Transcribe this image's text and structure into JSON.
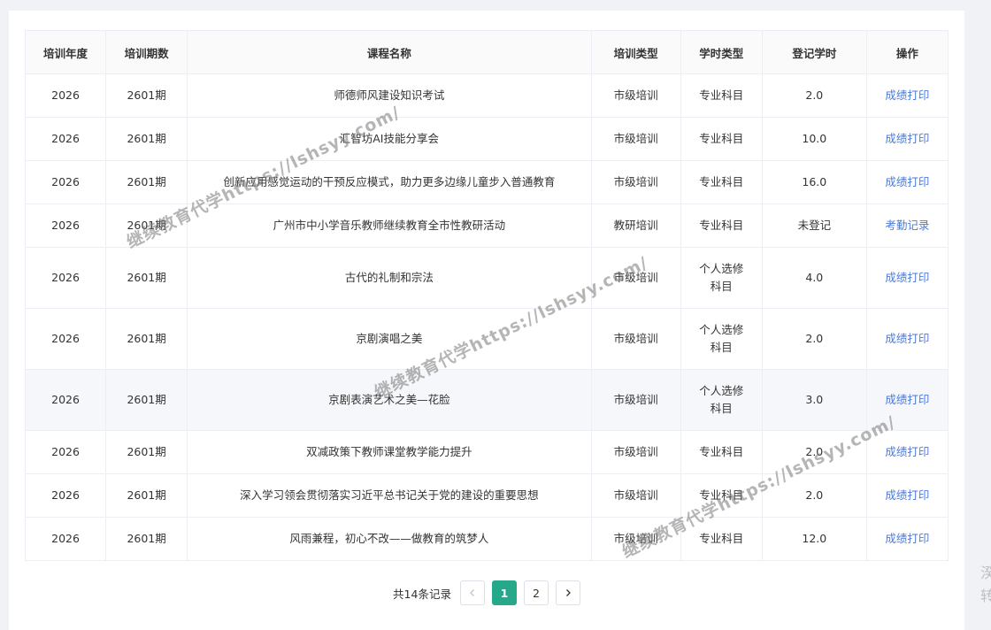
{
  "table": {
    "headers": [
      "培训年度",
      "培训期数",
      "课程名称",
      "培训类型",
      "学时类型",
      "登记学时",
      "操作"
    ],
    "rows": [
      {
        "year": "2026",
        "period": "2601期",
        "course": "师德师风建设知识考试",
        "type": "市级培训",
        "hour_type": "专业科目",
        "hours": "2.0",
        "action": "成绩打印"
      },
      {
        "year": "2026",
        "period": "2601期",
        "course": "汇智坊AI技能分享会",
        "type": "市级培训",
        "hour_type": "专业科目",
        "hours": "10.0",
        "action": "成绩打印"
      },
      {
        "year": "2026",
        "period": "2601期",
        "course": "创新应用感觉运动的干预反应模式，助力更多边缘儿童步入普通教育",
        "type": "市级培训",
        "hour_type": "专业科目",
        "hours": "16.0",
        "action": "成绩打印"
      },
      {
        "year": "2026",
        "period": "2601期",
        "course": "广州市中小学音乐教师继续教育全市性教研活动",
        "type": "教研培训",
        "hour_type": "专业科目",
        "hours": "未登记",
        "action": "考勤记录"
      },
      {
        "year": "2026",
        "period": "2601期",
        "course": "古代的礼制和宗法",
        "type": "市级培训",
        "hour_type_l1": "个人选修",
        "hour_type_l2": "科目",
        "hours": "4.0",
        "action": "成绩打印"
      },
      {
        "year": "2026",
        "period": "2601期",
        "course": "京剧演唱之美",
        "type": "市级培训",
        "hour_type_l1": "个人选修",
        "hour_type_l2": "科目",
        "hours": "2.0",
        "action": "成绩打印"
      },
      {
        "year": "2026",
        "period": "2601期",
        "course": "京剧表演艺术之美—花脸",
        "type": "市级培训",
        "hour_type_l1": "个人选修",
        "hour_type_l2": "科目",
        "hours": "3.0",
        "action": "成绩打印"
      },
      {
        "year": "2026",
        "period": "2601期",
        "course": "双减政策下教师课堂教学能力提升",
        "type": "市级培训",
        "hour_type": "专业科目",
        "hours": "2.0",
        "action": "成绩打印"
      },
      {
        "year": "2026",
        "period": "2601期",
        "course": "深入学习领会贯彻落实习近平总书记关于党的建设的重要思想",
        "type": "市级培训",
        "hour_type": "专业科目",
        "hours": "2.0",
        "action": "成绩打印"
      },
      {
        "year": "2026",
        "period": "2601期",
        "course": "风雨兼程，初心不改——做教育的筑梦人",
        "type": "市级培训",
        "hour_type": "专业科目",
        "hours": "12.0",
        "action": "成绩打印"
      }
    ]
  },
  "pagination": {
    "total_text": "共14条记录",
    "prev_icon": "chevron-left-icon",
    "next_icon": "chevron-right-icon",
    "pages": [
      "1",
      "2"
    ],
    "current": "1"
  },
  "watermark": {
    "text": "继续教育代学https://lshsyy.com/"
  },
  "edge": {
    "char1": "湀",
    "char2": "转"
  },
  "colors": {
    "accent": "#26a98a",
    "link": "#4b7ad8"
  }
}
